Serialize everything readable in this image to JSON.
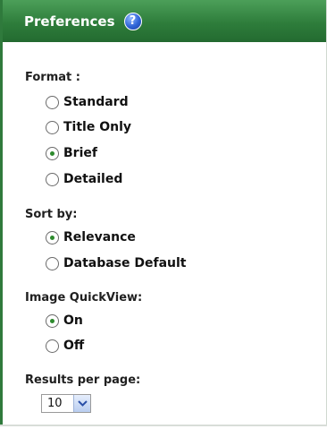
{
  "header": {
    "title": "Preferences",
    "help_icon": "help-icon",
    "help_glyph": "?"
  },
  "format": {
    "label": "Format :",
    "options": [
      {
        "label": "Standard",
        "checked": false
      },
      {
        "label": "Title Only",
        "checked": false
      },
      {
        "label": "Brief",
        "checked": true
      },
      {
        "label": "Detailed",
        "checked": false
      }
    ]
  },
  "sort": {
    "label": "Sort by:",
    "options": [
      {
        "label": "Relevance",
        "checked": true
      },
      {
        "label": "Database Default",
        "checked": false
      }
    ]
  },
  "quickview": {
    "label": "Image QuickView:",
    "options": [
      {
        "label": "On",
        "checked": true
      },
      {
        "label": "Off",
        "checked": false
      }
    ]
  },
  "results": {
    "label": "Results per page:",
    "selected": "10"
  },
  "colors": {
    "header_green": "#2e7d3b",
    "radio_dot": "#2d8a2d"
  }
}
